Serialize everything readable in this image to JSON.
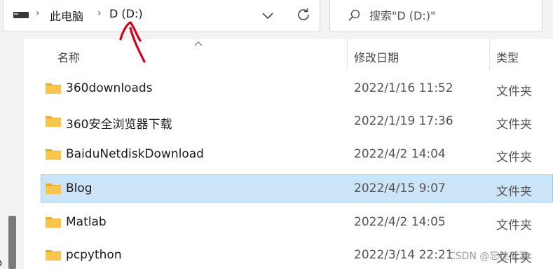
{
  "address": {
    "drive_icon": "drive-icon",
    "breadcrumb": [
      "此电脑",
      "D (D:)"
    ],
    "separator_icon": "chevron-right-icon",
    "dropdown_icon": "chevron-down-icon",
    "refresh_icon": "refresh-icon"
  },
  "search": {
    "icon": "search-icon",
    "placeholder": "搜索\"D (D:)\""
  },
  "columns": {
    "name": "名称",
    "date": "修改日期",
    "type": "类型",
    "sort_icon": "sort-ascending-icon"
  },
  "rows": [
    {
      "name": "360downloads",
      "date": "2022/1/16 11:52",
      "type": "文件夹",
      "selected": false
    },
    {
      "name": "360安全浏览器下载",
      "date": "2022/1/19 17:36",
      "type": "文件夹",
      "selected": false
    },
    {
      "name": "BaiduNetdiskDownload",
      "date": "2022/4/2 14:04",
      "type": "文件夹",
      "selected": false
    },
    {
      "name": "Blog",
      "date": "2022/4/15 9:07",
      "type": "文件夹",
      "selected": true
    },
    {
      "name": "Matlab",
      "date": "2022/4/2 14:05",
      "type": "文件夹",
      "selected": false
    },
    {
      "name": "pcpython",
      "date": "2022/3/14 22:21",
      "type": "文件夹",
      "selected": false
    }
  ],
  "nav": {
    "cut_text": "o"
  },
  "watermark": "CSDN @忘往芝游",
  "colors": {
    "selection": "#cce4f7",
    "selection_border": "#99c9ef",
    "folder": "#f8c64a",
    "annotation": "#d0021b"
  }
}
